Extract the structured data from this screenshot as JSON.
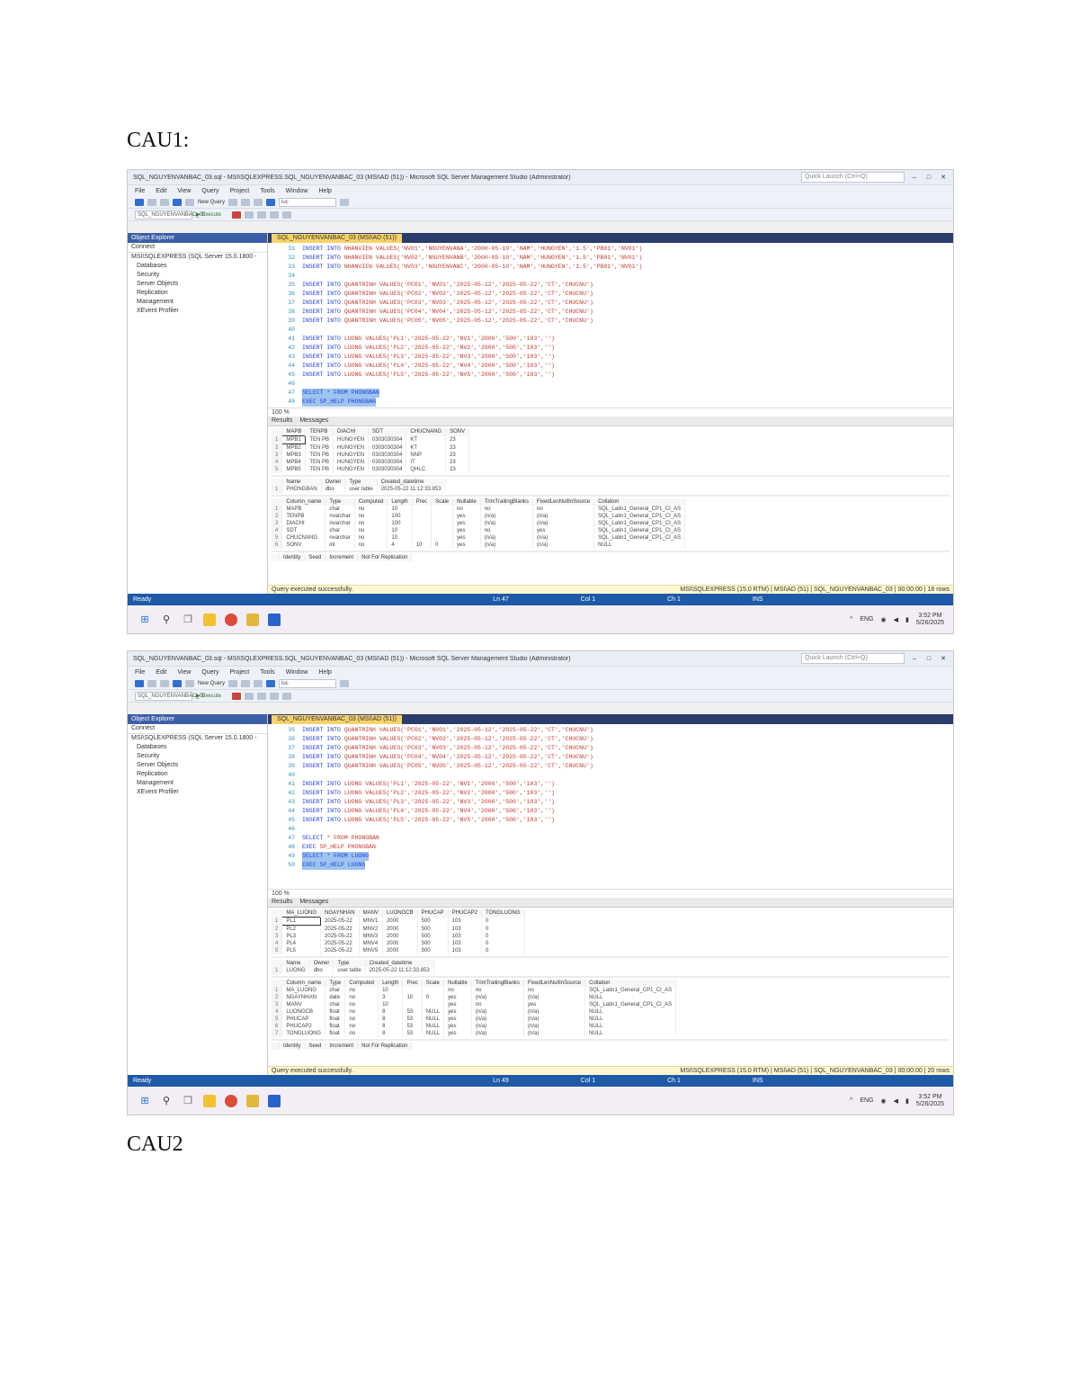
{
  "headings": [
    "CAU1:",
    "CAU2"
  ],
  "common": {
    "menu": [
      "File",
      "Edit",
      "View",
      "Query",
      "Project",
      "Tools",
      "Window",
      "Help"
    ],
    "quick_launch": "Quick Launch (Ctrl+Q)",
    "new_query": "New Query",
    "execute": "Execute",
    "search_box": "luc",
    "object_explorer_title": "Object Explorer",
    "connect_label": "Connect",
    "tree": [
      "Databases",
      "Security",
      "Server Objects",
      "Replication",
      "Management",
      "XEvent Profiler"
    ],
    "server_node": "MSI\\SQLEXPRESS (SQL Server 15.0.1800 -",
    "results_tab": "Results",
    "messages_tab": "Messages",
    "zoom": "100 %",
    "query_ok": "Query executed successfully.",
    "ready": "Ready",
    "server_status": "MSI\\SQLEXPRESS (15.0 RTM)",
    "user_status": "MSI\\AD (51)",
    "col": "Col 1",
    "ch": "Ch 1",
    "ins": "INS",
    "tray_lang": "ENG",
    "time": "3:52 PM",
    "date": "5/26/2025"
  },
  "screens": [
    {
      "title": "SQL_NGUYENVANBAC_03.sql - MSI\\SQLEXPRESS.SQL_NGUYENVANBAC_03 (MSI\\AD (51)) - Microsoft SQL Server Management Studio (Administrator)",
      "doc_tab": "SQL_NGUYENVANBAC_03 (MSI\\AD (51))",
      "code": [
        {
          "ln": "31",
          "kw": "INSERT INTO",
          "tx": "NHANVIEN VALUES('NV01','NGUYENVANA','2000-05-10','NAM','HUNGYEN','1.5','PB01','NV01')"
        },
        {
          "ln": "32",
          "kw": "INSERT INTO",
          "tx": "NHANVIEN VALUES('NV02','NGUYENVANB','2000-05-10','NAM','HUNGYEN','1.5','PB01','NV01')"
        },
        {
          "ln": "33",
          "kw": "INSERT INTO",
          "tx": "NHANVIEN VALUES('NV03','NGUYENVANC','2000-05-10','NAM','HUNGYEN','1.5','PB01','NV01')"
        },
        {
          "ln": "34",
          "kw": "",
          "tx": ""
        },
        {
          "ln": "35",
          "kw": "INSERT INTO",
          "tx": "QUANTRINH VALUES('PC01','NV01','2025-05-12','2025-05-22','CT','CHUCNU')"
        },
        {
          "ln": "36",
          "kw": "INSERT INTO",
          "tx": "QUANTRINH VALUES('PC02','NV02','2025-05-12','2025-05-22','CT','CHUCNU')"
        },
        {
          "ln": "37",
          "kw": "INSERT INTO",
          "tx": "QUANTRINH VALUES('PC03','NV03','2025-05-12','2025-05-22','CT','CHUCNU')"
        },
        {
          "ln": "38",
          "kw": "INSERT INTO",
          "tx": "QUANTRINH VALUES('PC04','NV04','2025-05-12','2025-05-22','CT','CHUCNU')"
        },
        {
          "ln": "39",
          "kw": "INSERT INTO",
          "tx": "QUANTRINH VALUES('PC05','NV05','2025-05-12','2025-05-22','CT','CHUCNU')"
        },
        {
          "ln": "40",
          "kw": "",
          "tx": ""
        },
        {
          "ln": "41",
          "kw": "INSERT INTO",
          "tx": "LUONG VALUES('PL1','2025-05-22','NV1','2000','500','103','')"
        },
        {
          "ln": "42",
          "kw": "INSERT INTO",
          "tx": "LUONG VALUES('PL2','2025-05-22','NV2','2000','500','103','')"
        },
        {
          "ln": "43",
          "kw": "INSERT INTO",
          "tx": "LUONG VALUES('PL3','2025-05-22','NV3','2000','500','103','')"
        },
        {
          "ln": "44",
          "kw": "INSERT INTO",
          "tx": "LUONG VALUES('PL4','2025-05-22','NV4','2000','500','103','')"
        },
        {
          "ln": "45",
          "kw": "INSERT INTO",
          "tx": "LUONG VALUES('PL5','2025-05-22','NV5','2000','500','103','')"
        },
        {
          "ln": "46",
          "kw": "",
          "tx": ""
        },
        {
          "ln": "47",
          "kw": "",
          "tx": "",
          "sel": "SELECT * FROM PHONGBAN"
        },
        {
          "ln": "48",
          "kw": "",
          "tx": "",
          "sel": "EXEC SP_HELP PHONGBAN"
        }
      ],
      "grid1": {
        "cols": [
          "MAPB",
          "TENPB",
          "DIACHI",
          "SDT",
          "CHUCNANG",
          "SONV"
        ],
        "rows": [
          [
            "MPB1",
            "TEN PB",
            "HUNGYEN",
            "0303030304",
            "KT",
            "23"
          ],
          [
            "MPB2",
            "TEN PB",
            "HUNGYEN",
            "0303030304",
            "KT",
            "23"
          ],
          [
            "MPB3",
            "TEN PB",
            "HUNGYEN",
            "0303030304",
            "NNP",
            "23"
          ],
          [
            "MPB4",
            "TEN PB",
            "HUNGYEN",
            "0303030304",
            "IT",
            "23"
          ],
          [
            "MPB5",
            "TEN PB",
            "HUNGYEN",
            "0303030304",
            "QHLC",
            "23"
          ]
        ]
      },
      "grid2": {
        "cols": [
          "Name",
          "Owner",
          "Type",
          "Created_datetime"
        ],
        "rows": [
          [
            "PHONGBAN",
            "dbo",
            "user table",
            "2025-05-22 11:12:33.853"
          ]
        ]
      },
      "grid3": {
        "cols": [
          "Column_name",
          "Type",
          "Computed",
          "Length",
          "Prec",
          "Scale",
          "Nullable",
          "TrimTrailingBlanks",
          "FixedLenNullInSource",
          "Collation"
        ],
        "rows": [
          [
            "MAPB",
            "char",
            "no",
            "10",
            "",
            "",
            "no",
            "no",
            "no",
            "SQL_Latin1_General_CP1_CI_AS"
          ],
          [
            "TENPB",
            "nvarchar",
            "no",
            "100",
            "",
            "",
            "yes",
            "(n/a)",
            "(n/a)",
            "SQL_Latin1_General_CP1_CI_AS"
          ],
          [
            "DIACHI",
            "nvarchar",
            "no",
            "100",
            "",
            "",
            "yes",
            "(n/a)",
            "(n/a)",
            "SQL_Latin1_General_CP1_CI_AS"
          ],
          [
            "SDT",
            "char",
            "no",
            "10",
            "",
            "",
            "yes",
            "no",
            "yes",
            "SQL_Latin1_General_CP1_CI_AS"
          ],
          [
            "CHUCNANG",
            "nvarchar",
            "no",
            "10",
            "",
            "",
            "yes",
            "(n/a)",
            "(n/a)",
            "SQL_Latin1_General_CP1_CI_AS"
          ],
          [
            "SONV",
            "int",
            "no",
            "4",
            "10",
            "0",
            "yes",
            "(n/a)",
            "(n/a)",
            "NULL"
          ]
        ]
      },
      "grid4_cols": [
        "Identity",
        "Seed",
        "Increment",
        "Not For Replication"
      ],
      "db_status": "SQL_NGUYENVANBAC_03",
      "time_status": "00:00:00",
      "rows_status": "18 rows",
      "ln": "Ln 47"
    },
    {
      "title": "SQL_NGUYENVANBAC_03.sql - MSI\\SQLEXPRESS.SQL_NGUYENVANBAC_03 (MSI\\AD (51)) - Microsoft SQL Server Management Studio (Administrator)",
      "doc_tab": "SQL_NGUYENVANBAC_03 (MSI\\AD (51))",
      "code": [
        {
          "ln": "35",
          "kw": "INSERT INTO",
          "tx": "QUANTRINH VALUES('PC01','NV01','2025-05-12','2025-05-22','CT','CHUCNU')"
        },
        {
          "ln": "36",
          "kw": "INSERT INTO",
          "tx": "QUANTRINH VALUES('PC02','NV02','2025-05-12','2025-05-22','CT','CHUCNU')"
        },
        {
          "ln": "37",
          "kw": "INSERT INTO",
          "tx": "QUANTRINH VALUES('PC03','NV03','2025-05-12','2025-05-22','CT','CHUCNU')"
        },
        {
          "ln": "38",
          "kw": "INSERT INTO",
          "tx": "QUANTRINH VALUES('PC04','NV04','2025-05-12','2025-05-22','CT','CHUCNU')"
        },
        {
          "ln": "39",
          "kw": "INSERT INTO",
          "tx": "QUANTRINH VALUES('PC05','NV05','2025-05-12','2025-05-22','CT','CHUCNU')"
        },
        {
          "ln": "40",
          "kw": "",
          "tx": ""
        },
        {
          "ln": "41",
          "kw": "INSERT INTO",
          "tx": "LUONG VALUES('PL1','2025-05-22','NV1','2000','500','103','')"
        },
        {
          "ln": "42",
          "kw": "INSERT INTO",
          "tx": "LUONG VALUES('PL2','2025-05-22','NV2','2000','500','103','')"
        },
        {
          "ln": "43",
          "kw": "INSERT INTO",
          "tx": "LUONG VALUES('PL3','2025-05-22','NV3','2000','500','103','')"
        },
        {
          "ln": "44",
          "kw": "INSERT INTO",
          "tx": "LUONG VALUES('PL4','2025-05-22','NV4','2000','500','103','')"
        },
        {
          "ln": "45",
          "kw": "INSERT INTO",
          "tx": "LUONG VALUES('PL5','2025-05-22','NV5','2000','500','103','')"
        },
        {
          "ln": "46",
          "kw": "",
          "tx": ""
        },
        {
          "ln": "47",
          "kw": "SELECT",
          "tx": "* FROM PHONGBAN"
        },
        {
          "ln": "48",
          "kw": "EXEC",
          "tx": "SP_HELP PHONGBAN"
        },
        {
          "ln": "49",
          "kw": "",
          "tx": "",
          "sel": "SELECT * FROM LUONG"
        },
        {
          "ln": "50",
          "kw": "",
          "tx": "",
          "sel": "EXEC SP_HELP LUONG"
        }
      ],
      "grid1": {
        "cols": [
          "MA_LUONG",
          "NGAYNHAN",
          "MANV",
          "LUONGCB",
          "PHUCAP",
          "PHUCAP2",
          "TONGLUONG"
        ],
        "rows": [
          [
            "PL1",
            "2025-05-22",
            "MNV1",
            "2000",
            "500",
            "103",
            "0"
          ],
          [
            "PL2",
            "2025-05-22",
            "MNV2",
            "2000",
            "500",
            "103",
            "0"
          ],
          [
            "PL3",
            "2025-05-22",
            "MNV3",
            "2000",
            "500",
            "103",
            "0"
          ],
          [
            "PL4",
            "2025-05-22",
            "MNV4",
            "2000",
            "500",
            "103",
            "0"
          ],
          [
            "PL5",
            "2025-05-22",
            "MNV5",
            "2000",
            "500",
            "103",
            "0"
          ]
        ]
      },
      "grid2": {
        "cols": [
          "Name",
          "Owner",
          "Type",
          "Created_datetime"
        ],
        "rows": [
          [
            "LUONG",
            "dbo",
            "user table",
            "2025-05-22 11:12:33.853"
          ]
        ]
      },
      "grid3": {
        "cols": [
          "Column_name",
          "Type",
          "Computed",
          "Length",
          "Prec",
          "Scale",
          "Nullable",
          "TrimTrailingBlanks",
          "FixedLenNullInSource",
          "Collation"
        ],
        "rows": [
          [
            "MA_LUONG",
            "char",
            "no",
            "10",
            "",
            "",
            "no",
            "no",
            "no",
            "SQL_Latin1_General_CP1_CI_AS"
          ],
          [
            "NGAYNHAN",
            "date",
            "no",
            "3",
            "10",
            "0",
            "yes",
            "(n/a)",
            "(n/a)",
            "NULL"
          ],
          [
            "MANV",
            "char",
            "no",
            "10",
            "",
            "",
            "yes",
            "no",
            "yes",
            "SQL_Latin1_General_CP1_CI_AS"
          ],
          [
            "LUONGCB",
            "float",
            "no",
            "8",
            "53",
            "NULL",
            "yes",
            "(n/a)",
            "(n/a)",
            "NULL"
          ],
          [
            "PHUCAP",
            "float",
            "no",
            "8",
            "53",
            "NULL",
            "yes",
            "(n/a)",
            "(n/a)",
            "NULL"
          ],
          [
            "PHUCAP2",
            "float",
            "no",
            "8",
            "53",
            "NULL",
            "yes",
            "(n/a)",
            "(n/a)",
            "NULL"
          ],
          [
            "TONGLUONG",
            "float",
            "no",
            "8",
            "53",
            "NULL",
            "yes",
            "(n/a)",
            "(n/a)",
            "NULL"
          ]
        ]
      },
      "grid4_cols": [
        "Identity",
        "Seed",
        "Increment",
        "Not For Replication"
      ],
      "db_status": "SQL_NGUYENVANBAC_03",
      "time_status": "00:00:00",
      "rows_status": "20 rows",
      "ln": "Ln 49"
    }
  ]
}
